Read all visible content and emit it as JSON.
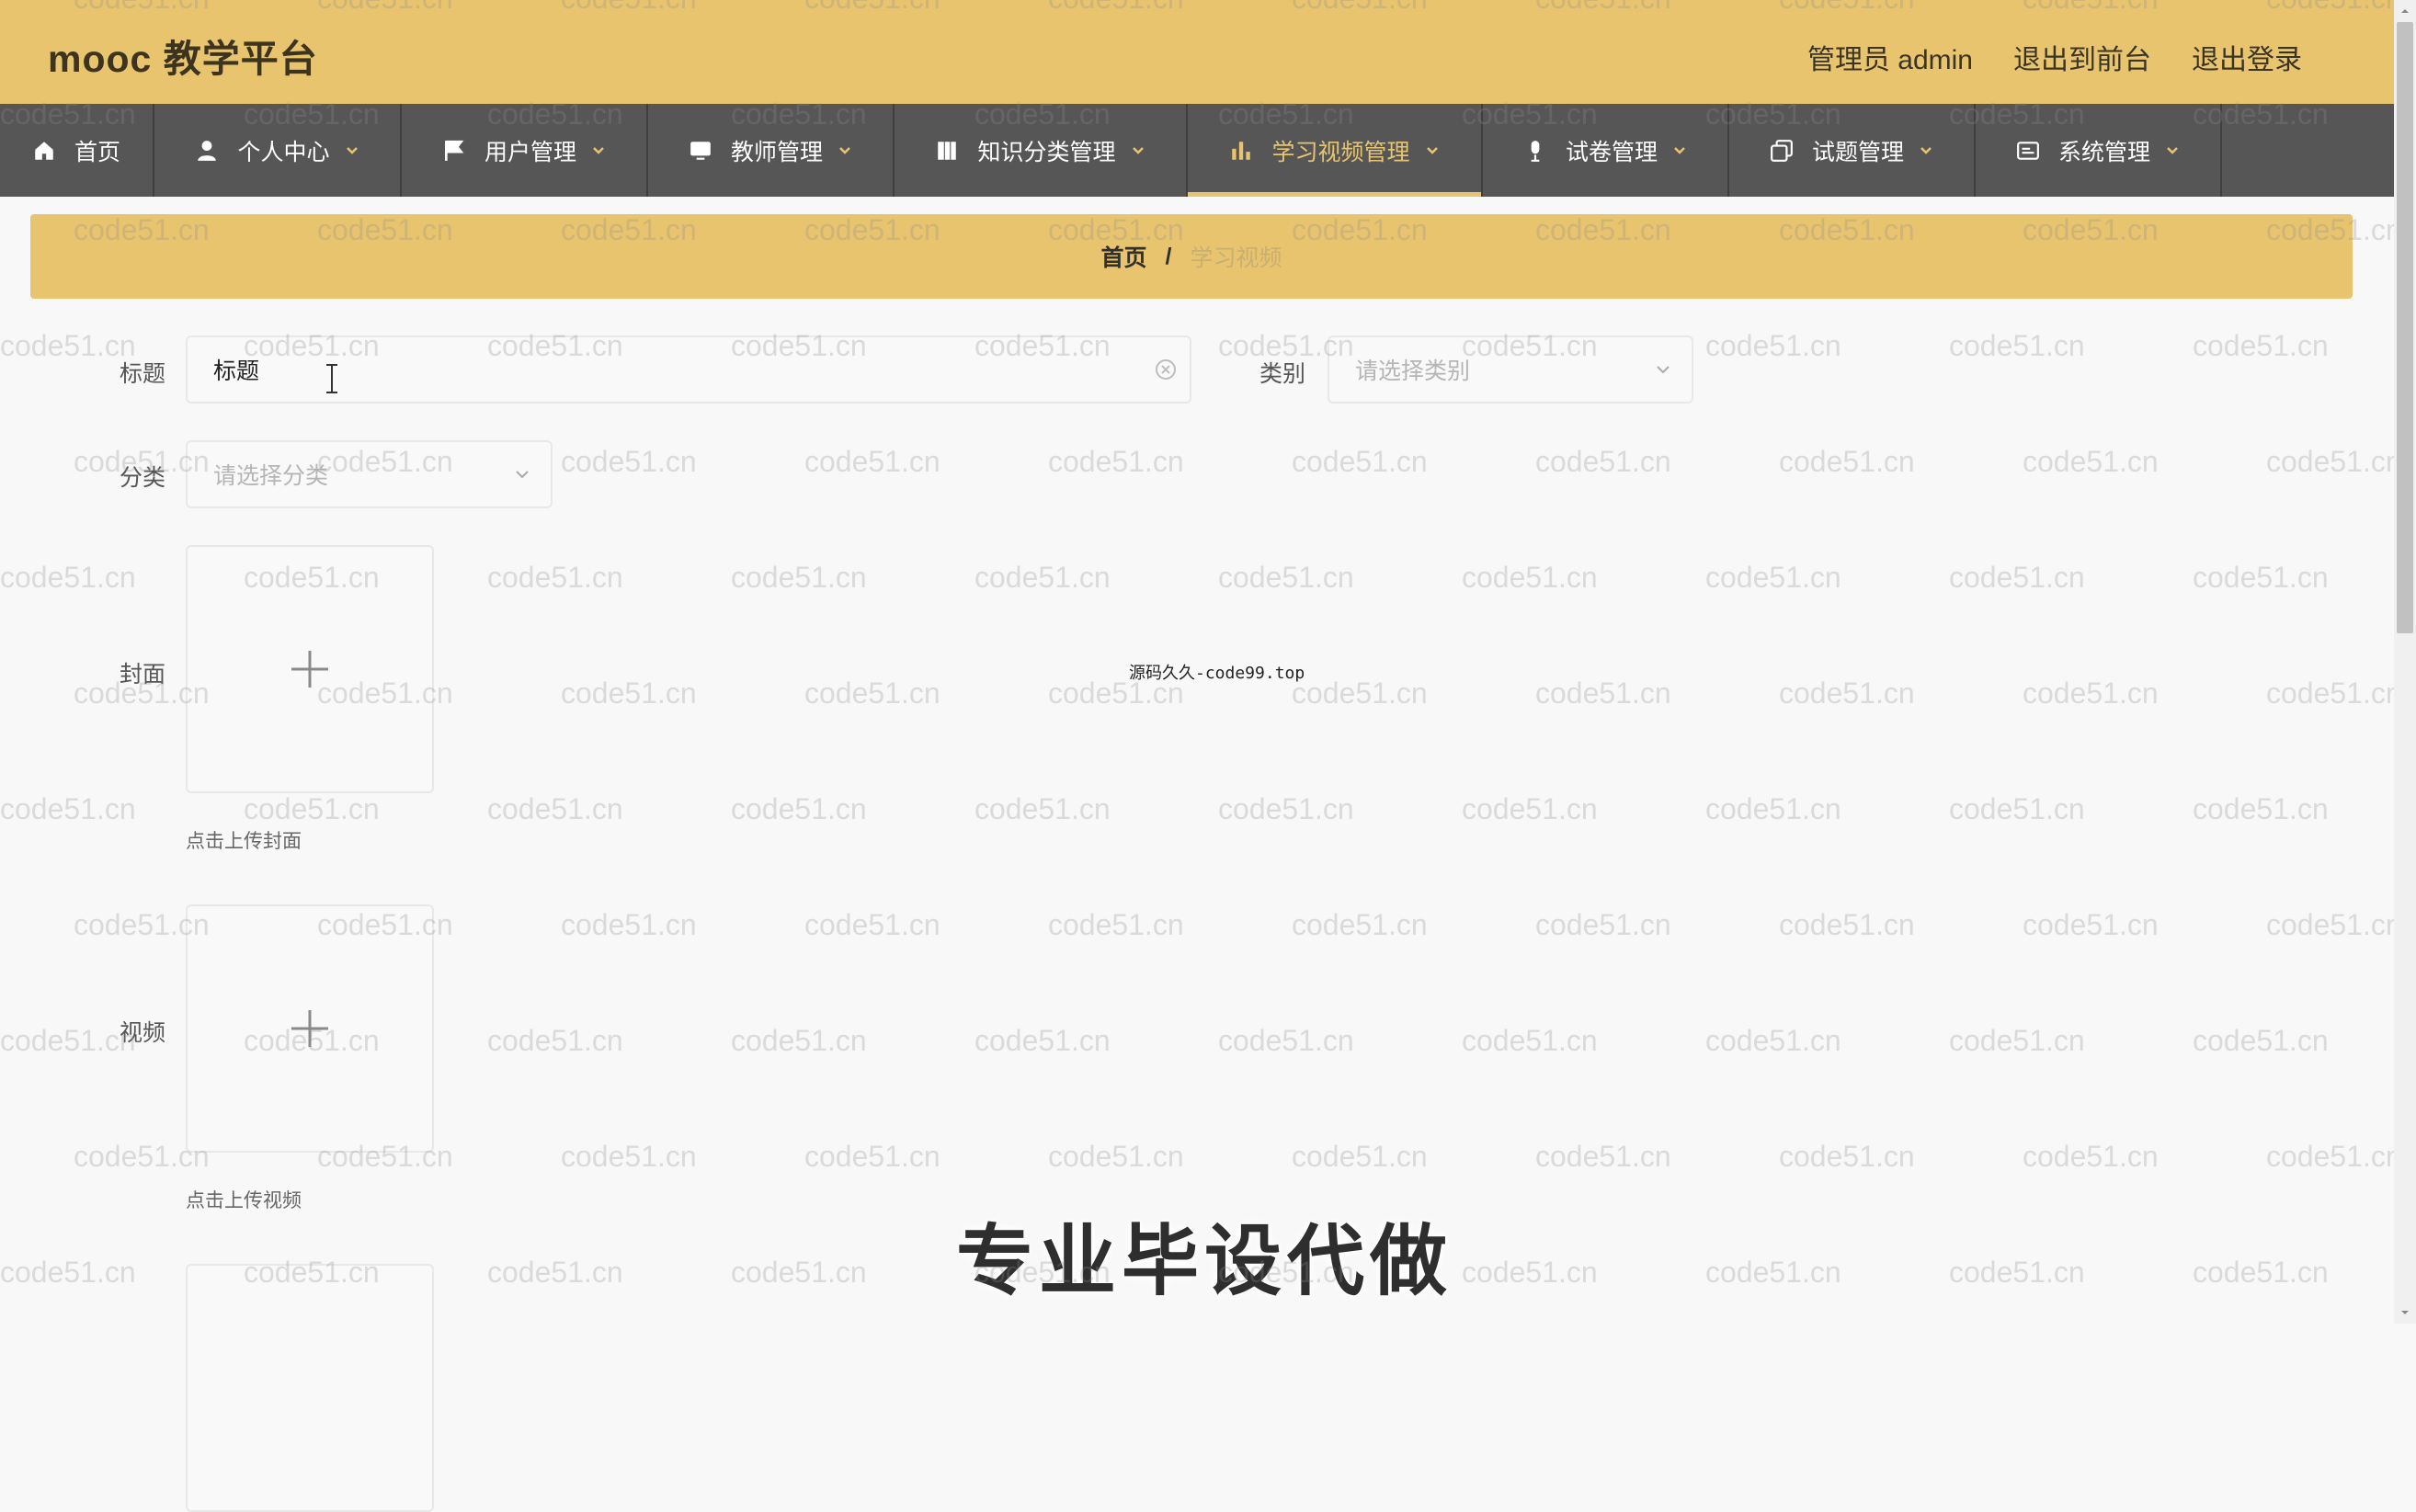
{
  "header": {
    "title": "mooc 教学平台",
    "admin_label": "管理员 admin",
    "exit_front": "退出到前台",
    "logout": "退出登录"
  },
  "nav": {
    "items": [
      {
        "label": "首页",
        "icon": "home-icon"
      },
      {
        "label": "个人中心",
        "icon": "person-icon"
      },
      {
        "label": "用户管理",
        "icon": "flag-icon"
      },
      {
        "label": "教师管理",
        "icon": "monitor-icon"
      },
      {
        "label": "知识分类管理",
        "icon": "book-icon"
      },
      {
        "label": "学习视频管理",
        "icon": "bar-chart-icon"
      },
      {
        "label": "试卷管理",
        "icon": "microphone-icon"
      },
      {
        "label": "试题管理",
        "icon": "copy-icon"
      },
      {
        "label": "系统管理",
        "icon": "card-icon"
      }
    ],
    "active": "学习视频管理"
  },
  "breadcrumb": {
    "home": "首页",
    "separator": "/",
    "current": "学习视频"
  },
  "form": {
    "title_label": "标题",
    "title_value": "标题",
    "category_label": "类别",
    "category_placeholder": "请选择类别",
    "classify_label": "分类",
    "classify_placeholder": "请选择分类",
    "cover_label": "封面",
    "cover_hint": "点击上传封面",
    "video_label": "视频",
    "video_hint": "点击上传视频"
  },
  "overlay": {
    "center_note": "源码久久-code99.top",
    "promo": "专业毕设代做",
    "watermark": "code51.cn"
  },
  "colors": {
    "accent": "#e8c46f",
    "nav_bg": "#565656",
    "page_bg": "#f8f8f8"
  }
}
